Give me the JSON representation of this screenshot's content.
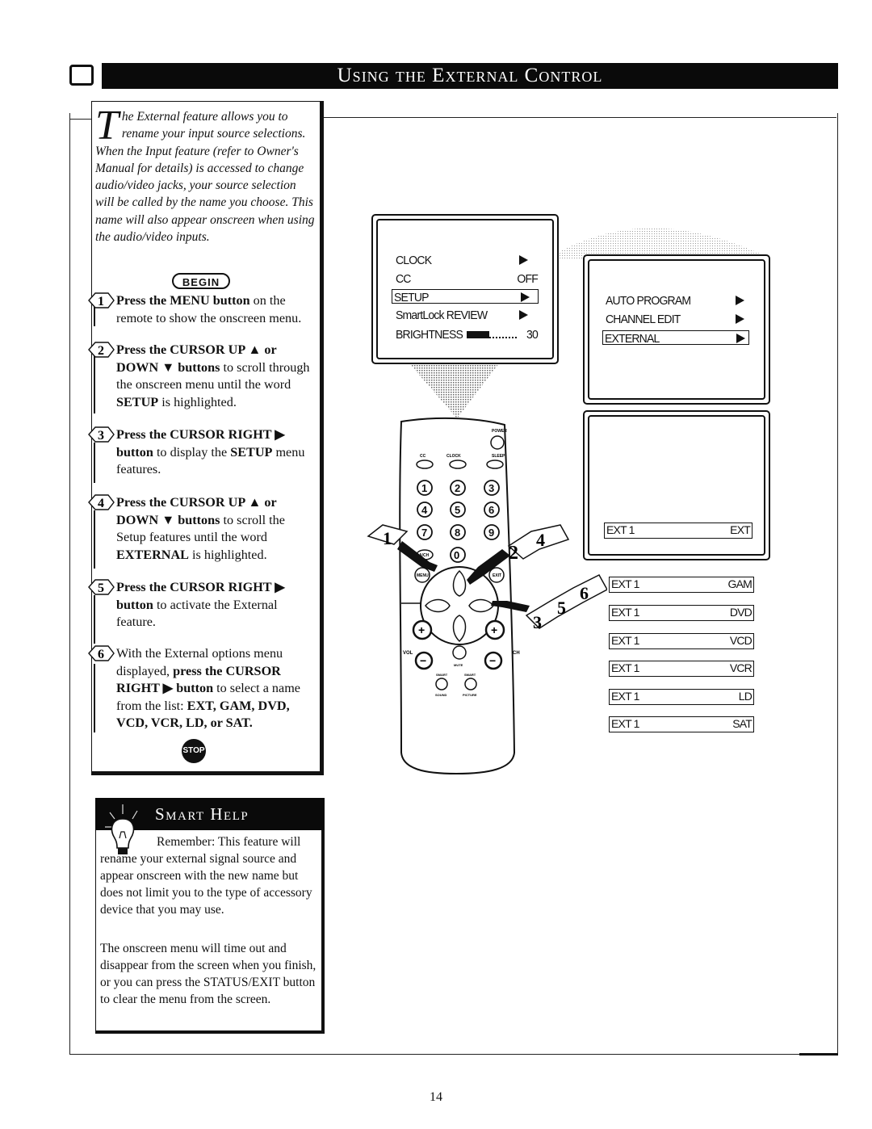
{
  "header": {
    "title": "Using the External Control",
    "icon": "tv-screen-icon"
  },
  "intro": {
    "drop_cap": "T",
    "text": "he External feature allows you to rename your input source selections. When the Input feature (refer to Owner's Manual for details) is accessed to change audio/video jacks, your source selection will be called by the name you choose. This name will also appear onscreen when using the audio/video inputs."
  },
  "begin_label": "BEGIN",
  "steps": [
    {
      "num": "1",
      "bold": "Press the MENU button",
      "rest": " on the remote to show the onscreen menu."
    },
    {
      "num": "2",
      "bold": "Press the CURSOR UP ▲ or DOWN ▼ buttons",
      "rest": " to scroll through the onscreen menu until the word ",
      "bold2": "SETUP",
      "rest2": " is highlighted."
    },
    {
      "num": "3",
      "bold": "Press the CURSOR RIGHT ▶ button",
      "rest": " to display the ",
      "bold2": "SETUP",
      "rest2": " menu features."
    },
    {
      "num": "4",
      "bold": "Press the CURSOR UP ▲ or DOWN ▼ buttons",
      "rest": " to scroll the Setup features until the word ",
      "bold2": "EXTERNAL",
      "rest2": " is highlighted."
    },
    {
      "num": "5",
      "bold": "Press the CURSOR RIGHT ▶ button",
      "rest": " to activate the External feature."
    },
    {
      "num": "6",
      "pre": "With the External options menu displayed, ",
      "bold": "press the CURSOR RIGHT ▶ button",
      "rest": " to select a name from the list: ",
      "bold2": "EXT, GAM, DVD, VCD, VCR, LD, or SAT."
    }
  ],
  "stop_label": "STOP",
  "smart_help": {
    "title": "Smart Help",
    "p1": "Remember: This feature will rename your external signal source and appear onscreen with the new name but does not limit you to the type of accessory device that you may use.",
    "p2": "The onscreen menu will time out and disappear from the screen when you finish, or you can press the STATUS/EXIT button to clear the menu from the screen."
  },
  "main_menu": {
    "items": [
      {
        "label": "CLOCK",
        "value": "▶"
      },
      {
        "label": "CC",
        "value": "OFF"
      },
      {
        "label": "SETUP",
        "value": "▶",
        "selected": true
      },
      {
        "label": "SmartLock REVIEW",
        "value": "▶"
      },
      {
        "label": "BRIGHTNESS",
        "value": "30",
        "level": 30
      }
    ]
  },
  "setup_menu": {
    "items": [
      {
        "label": "AUTO PROGRAM",
        "value": "▶"
      },
      {
        "label": "CHANNEL EDIT",
        "value": "▶"
      },
      {
        "label": "EXTERNAL",
        "value": "▶",
        "selected": true
      }
    ]
  },
  "external_screen": {
    "source": "EXT 1",
    "name": "EXT"
  },
  "external_options": [
    {
      "source": "EXT 1",
      "name": "GAM"
    },
    {
      "source": "EXT 1",
      "name": "DVD"
    },
    {
      "source": "EXT 1",
      "name": "VCD"
    },
    {
      "source": "EXT 1",
      "name": "VCR"
    },
    {
      "source": "EXT 1",
      "name": "LD"
    },
    {
      "source": "EXT 1",
      "name": "SAT"
    }
  ],
  "remote": {
    "power": "POWER",
    "top_buttons": [
      "CC",
      "CLOCK",
      "SLEEP"
    ],
    "digits": [
      "1",
      "2",
      "3",
      "4",
      "5",
      "6",
      "7",
      "8",
      "9"
    ],
    "ach": "A/CH",
    "zero": "0",
    "menu": "MENU",
    "exit": "EXIT",
    "vol": "VOL",
    "ch": "CH",
    "mute": "MUTE",
    "smart_sound": [
      "SMART",
      "SOUND"
    ],
    "smart_picture": [
      "SMART",
      "PICTURE"
    ],
    "callouts_left": [
      "1"
    ],
    "callouts_top": [
      "2",
      "4"
    ],
    "callouts_right": [
      "3",
      "5",
      "6"
    ]
  },
  "page_number": "14"
}
